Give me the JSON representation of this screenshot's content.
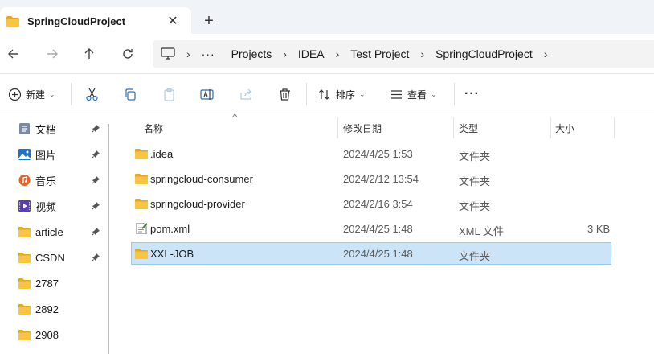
{
  "tab": {
    "title": "SpringCloudProject",
    "close": "✕",
    "new": "+"
  },
  "nav": {
    "back": "back",
    "forward": "forward",
    "up": "up",
    "refresh": "refresh",
    "breadcrumbs": [
      "Projects",
      "IDEA",
      "Test Project",
      "SpringCloudProject"
    ],
    "more": "···"
  },
  "toolbar": {
    "new_label": "新建",
    "sort_label": "排序",
    "view_label": "查看",
    "more": "···"
  },
  "sidebar": {
    "items": [
      {
        "label": "文档",
        "icon": "documents-icon",
        "pinned": true
      },
      {
        "label": "图片",
        "icon": "pictures-icon",
        "pinned": true
      },
      {
        "label": "音乐",
        "icon": "music-icon",
        "pinned": true
      },
      {
        "label": "视频",
        "icon": "videos-icon",
        "pinned": true
      },
      {
        "label": "article",
        "icon": "folder-icon",
        "pinned": true
      },
      {
        "label": "CSDN",
        "icon": "folder-icon",
        "pinned": true
      },
      {
        "label": "2787",
        "icon": "folder-icon",
        "pinned": false
      },
      {
        "label": "2892",
        "icon": "folder-icon",
        "pinned": false
      },
      {
        "label": "2908",
        "icon": "folder-icon",
        "pinned": false
      }
    ]
  },
  "columns": {
    "name": "名称",
    "modified": "修改日期",
    "type": "类型",
    "size": "大小"
  },
  "files": [
    {
      "name": ".idea",
      "modified": "2024/4/25 1:53",
      "type": "文件夹",
      "size": "",
      "icon": "folder-icon",
      "selected": false
    },
    {
      "name": "springcloud-consumer",
      "modified": "2024/2/12 13:54",
      "type": "文件夹",
      "size": "",
      "icon": "folder-icon",
      "selected": false
    },
    {
      "name": "springcloud-provider",
      "modified": "2024/2/16 3:54",
      "type": "文件夹",
      "size": "",
      "icon": "folder-icon",
      "selected": false
    },
    {
      "name": "pom.xml",
      "modified": "2024/4/25 1:48",
      "type": "XML 文件",
      "size": "3 KB",
      "icon": "xml-file-icon",
      "selected": false
    },
    {
      "name": "XXL-JOB",
      "modified": "2024/4/25 1:48",
      "type": "文件夹",
      "size": "",
      "icon": "folder-icon",
      "selected": true
    }
  ],
  "colors": {
    "folder": "#f7c443",
    "folder_dark": "#e8a817",
    "selection": "#cce4f7",
    "selection_border": "#99c9ef"
  }
}
